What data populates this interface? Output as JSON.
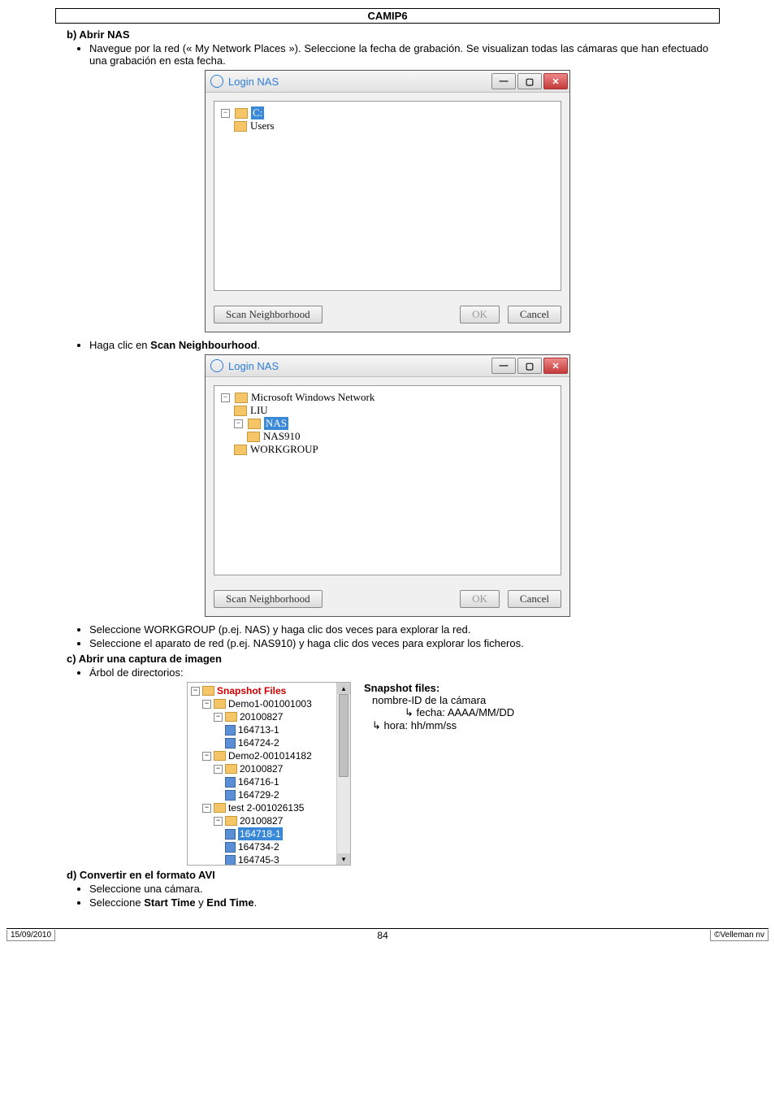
{
  "doc": {
    "header_title": "CAMIP6",
    "footer_date": "15/09/2010",
    "footer_page": "84",
    "footer_copyright": "©Velleman nv"
  },
  "section_b": {
    "heading": "b) Abrir NAS",
    "bullet1": "Navegue por la red (« My Network Places »). Seleccione la fecha de grabación. Se visualizan todas las cámaras que han efectuado una grabación en esta fecha.",
    "bullet2_pre": "Haga clic en ",
    "bullet2_bold": "Scan Neighbourhood",
    "bullet2_post": ".",
    "bullet3": "Seleccione WORKGROUP (p.ej. NAS) y haga clic dos veces para explorar la red.",
    "bullet4": "Seleccione el aparato de red (p.ej. NAS910) y haga clic dos veces para explorar los ficheros."
  },
  "dialog1": {
    "title": "Login NAS",
    "root_label": "C:",
    "child1": "Users",
    "scan_btn": "Scan Neighborhood",
    "ok_btn": "OK",
    "cancel_btn": "Cancel"
  },
  "dialog2": {
    "title": "Login NAS",
    "net_root": "Microsoft Windows Network",
    "net_child1": "LIU",
    "net_child2": "NAS",
    "net_grandchild": "NAS910",
    "net_child3": "WORKGROUP",
    "scan_btn": "Scan Neighborhood",
    "ok_btn": "OK",
    "cancel_btn": "Cancel"
  },
  "section_c": {
    "heading": "c) Abrir una captura de imagen",
    "bullet1": "Árbol de directorios:"
  },
  "snapshot": {
    "root": "Snapshot Files",
    "cam1": "Demo1-001001003",
    "date1": "20100827",
    "file1a": "164713-1",
    "file1b": "164724-2",
    "cam2": "Demo2-001014182",
    "date2": "20100827",
    "file2a": "164716-1",
    "file2b": "164729-2",
    "cam3": "test 2-001026135",
    "date3": "20100827",
    "file3a": "164718-1",
    "file3b": "164734-2",
    "file3c": "164745-3"
  },
  "legend": {
    "title": "Snapshot files:",
    "line1": "nombre-ID de la cámara",
    "line2": "↳ fecha: AAAA/MM/DD",
    "line3": "↳ hora: hh/mm/ss"
  },
  "section_d": {
    "heading": "d) Convertir en el formato AVI",
    "bullet1": "Seleccione una cámara.",
    "bullet2_pre": "Seleccione ",
    "bullet2_b1": "Start Time",
    "bullet2_mid": " y ",
    "bullet2_b2": "End Time",
    "bullet2_post": "."
  }
}
